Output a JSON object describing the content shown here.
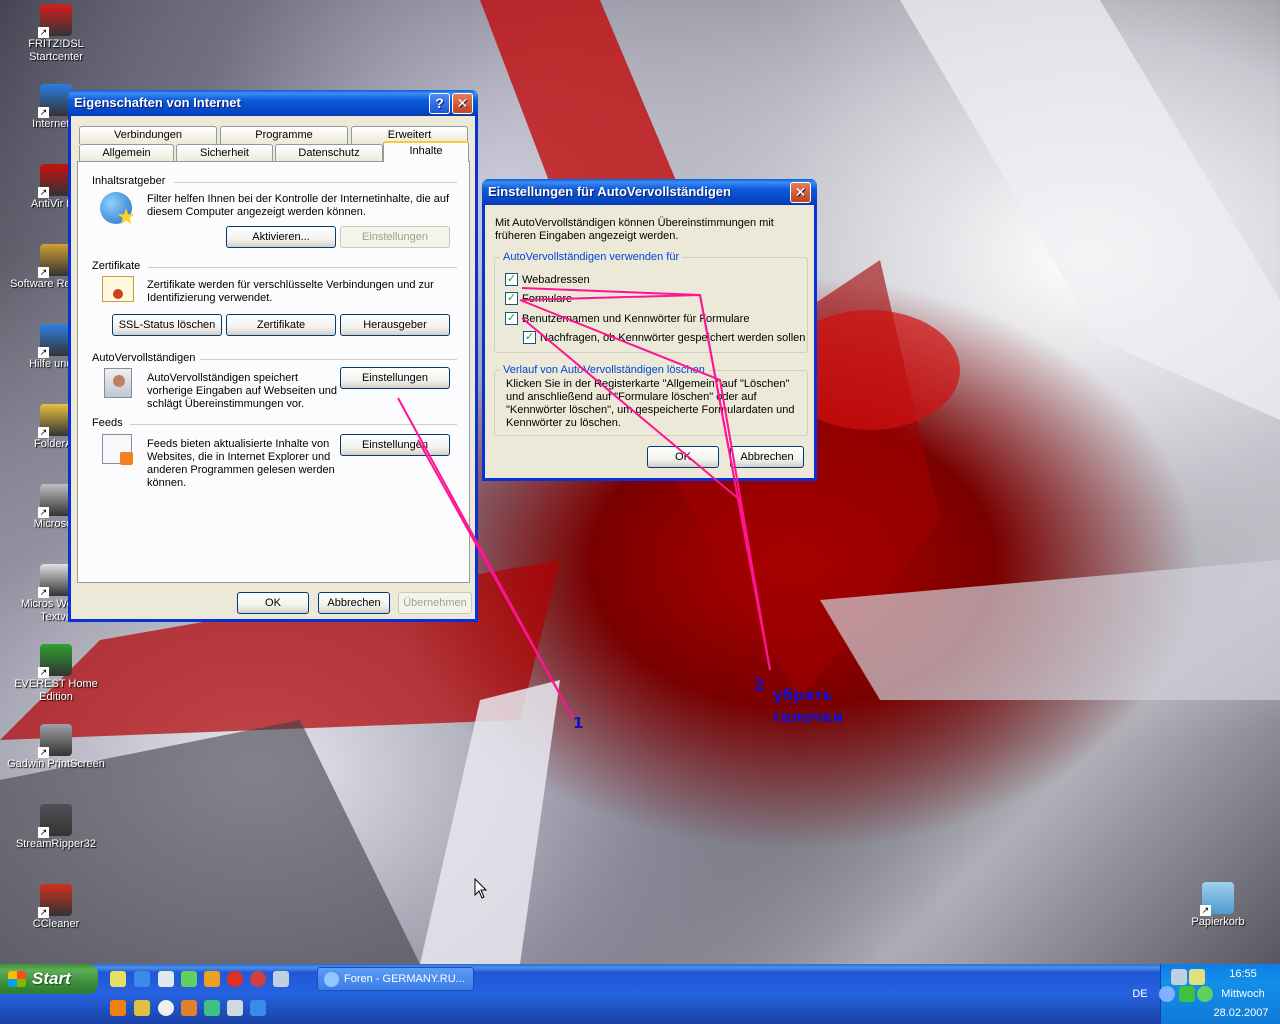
{
  "desktop": {
    "icons": [
      {
        "label": "FRITZ!DSL Startcenter",
        "icon": "fritz-icon",
        "color": "#d42020"
      },
      {
        "label": "Internet E",
        "icon": "internet-explorer-icon",
        "color": "#2a7de1"
      },
      {
        "label": "AntiVir PE",
        "icon": "antivir-icon",
        "color": "#c81010"
      },
      {
        "label": "Software Re Wizar",
        "icon": "software-wizard-icon",
        "color": "#d0a030"
      },
      {
        "label": "Hilfe und S",
        "icon": "help-icon",
        "color": "#3080e0"
      },
      {
        "label": "FolderAc",
        "icon": "folder-icon",
        "color": "#e8c040"
      },
      {
        "label": "Microsoft",
        "icon": "microsoft-icon",
        "color": "#c0c0c0"
      },
      {
        "label": "Micros Works-Textve",
        "icon": "works-icon",
        "color": "#e0e0e0"
      },
      {
        "label": "EVEREST Home Edition",
        "icon": "everest-icon",
        "color": "#30a030"
      },
      {
        "label": "Gadwin PrintScreen",
        "icon": "camera-icon",
        "color": "#a0a0a8"
      },
      {
        "label": "StreamRipper32",
        "icon": "streamripper-icon",
        "color": "#505058"
      },
      {
        "label": "CCleaner",
        "icon": "ccleaner-icon",
        "color": "#d03020"
      }
    ],
    "recycle_bin": "Papierkorb"
  },
  "internet_options": {
    "title": "Eigenschaften von Internet",
    "help_glyph": "?",
    "close_glyph": "✕",
    "tabs_row1": [
      "Verbindungen",
      "Programme",
      "Erweitert"
    ],
    "tabs_row2": [
      "Allgemein",
      "Sicherheit",
      "Datenschutz",
      "Inhalte"
    ],
    "active_tab": "Inhalte",
    "content_advisor": {
      "title": "Inhaltsratgeber",
      "text": "Filter helfen Ihnen bei der Kontrolle der Internetinhalte, die auf diesem Computer angezeigt werden können.",
      "enable_button": "Aktivieren...",
      "settings_button": "Einstellungen"
    },
    "certificates": {
      "title": "Zertifikate",
      "text": "Zertifikate werden für verschlüsselte Verbindungen und zur Identifizierung verwendet.",
      "ssl_button": "SSL-Status löschen",
      "cert_button": "Zertifikate",
      "publisher_button": "Herausgeber"
    },
    "autocomplete": {
      "title": "AutoVervollständigen",
      "text": "AutoVervollständigen speichert vorherige Eingaben auf Webseiten und schlägt Übereinstimmungen vor.",
      "settings_button": "Einstellungen"
    },
    "feeds": {
      "title": "Feeds",
      "text": "Feeds bieten aktualisierte Inhalte von Websites, die in Internet Explorer und anderen Programmen gelesen werden können.",
      "settings_button": "Einstellungen"
    },
    "ok": "OK",
    "cancel": "Abbrechen",
    "apply": "Übernehmen"
  },
  "autocomplete_dialog": {
    "title": "Einstellungen für AutoVervollständigen",
    "close_glyph": "✕",
    "intro": "Mit AutoVervollständigen können Übereinstimmungen mit früheren Eingaben angezeigt werden.",
    "use_for_legend": "AutoVervollständigen verwenden für",
    "checkboxes": [
      {
        "label": "Webadressen",
        "checked": true
      },
      {
        "label": "Formulare",
        "checked": true
      },
      {
        "label": "Benutzernamen und Kennwörter für Formulare",
        "checked": true
      },
      {
        "label": "Nachfragen, ob Kennwörter gespeichert werden sollen",
        "checked": true
      }
    ],
    "check_glyph": "✓",
    "history_legend": "Verlauf von AutoVervollständigen löschen",
    "history_text": "Klicken Sie in der Registerkarte \"Allgemein\" auf \"Löschen\" und anschließend auf \"Formulare löschen\" oder auf \"Kennwörter löschen\", um gespeicherte Formulardaten und Kennwörter zu löschen.",
    "ok": "OK",
    "cancel": "Abbrechen"
  },
  "annotations": {
    "label1": "1",
    "label2": "2",
    "note_line1": "убрать",
    "note_line2": "галочки",
    "arrow_color": "#ff1493"
  },
  "taskbar": {
    "start": "Start",
    "task_button": "Foren - GERMANY.RU...",
    "language": "DE",
    "time": "16:55",
    "weekday": "Mittwoch",
    "date": "28.02.2007"
  },
  "colors": {
    "xp_blue": "#0831d9",
    "dialog_bg": "#ece9d8",
    "start_green": "#3d913d",
    "annotation_blue": "#1010d0"
  }
}
